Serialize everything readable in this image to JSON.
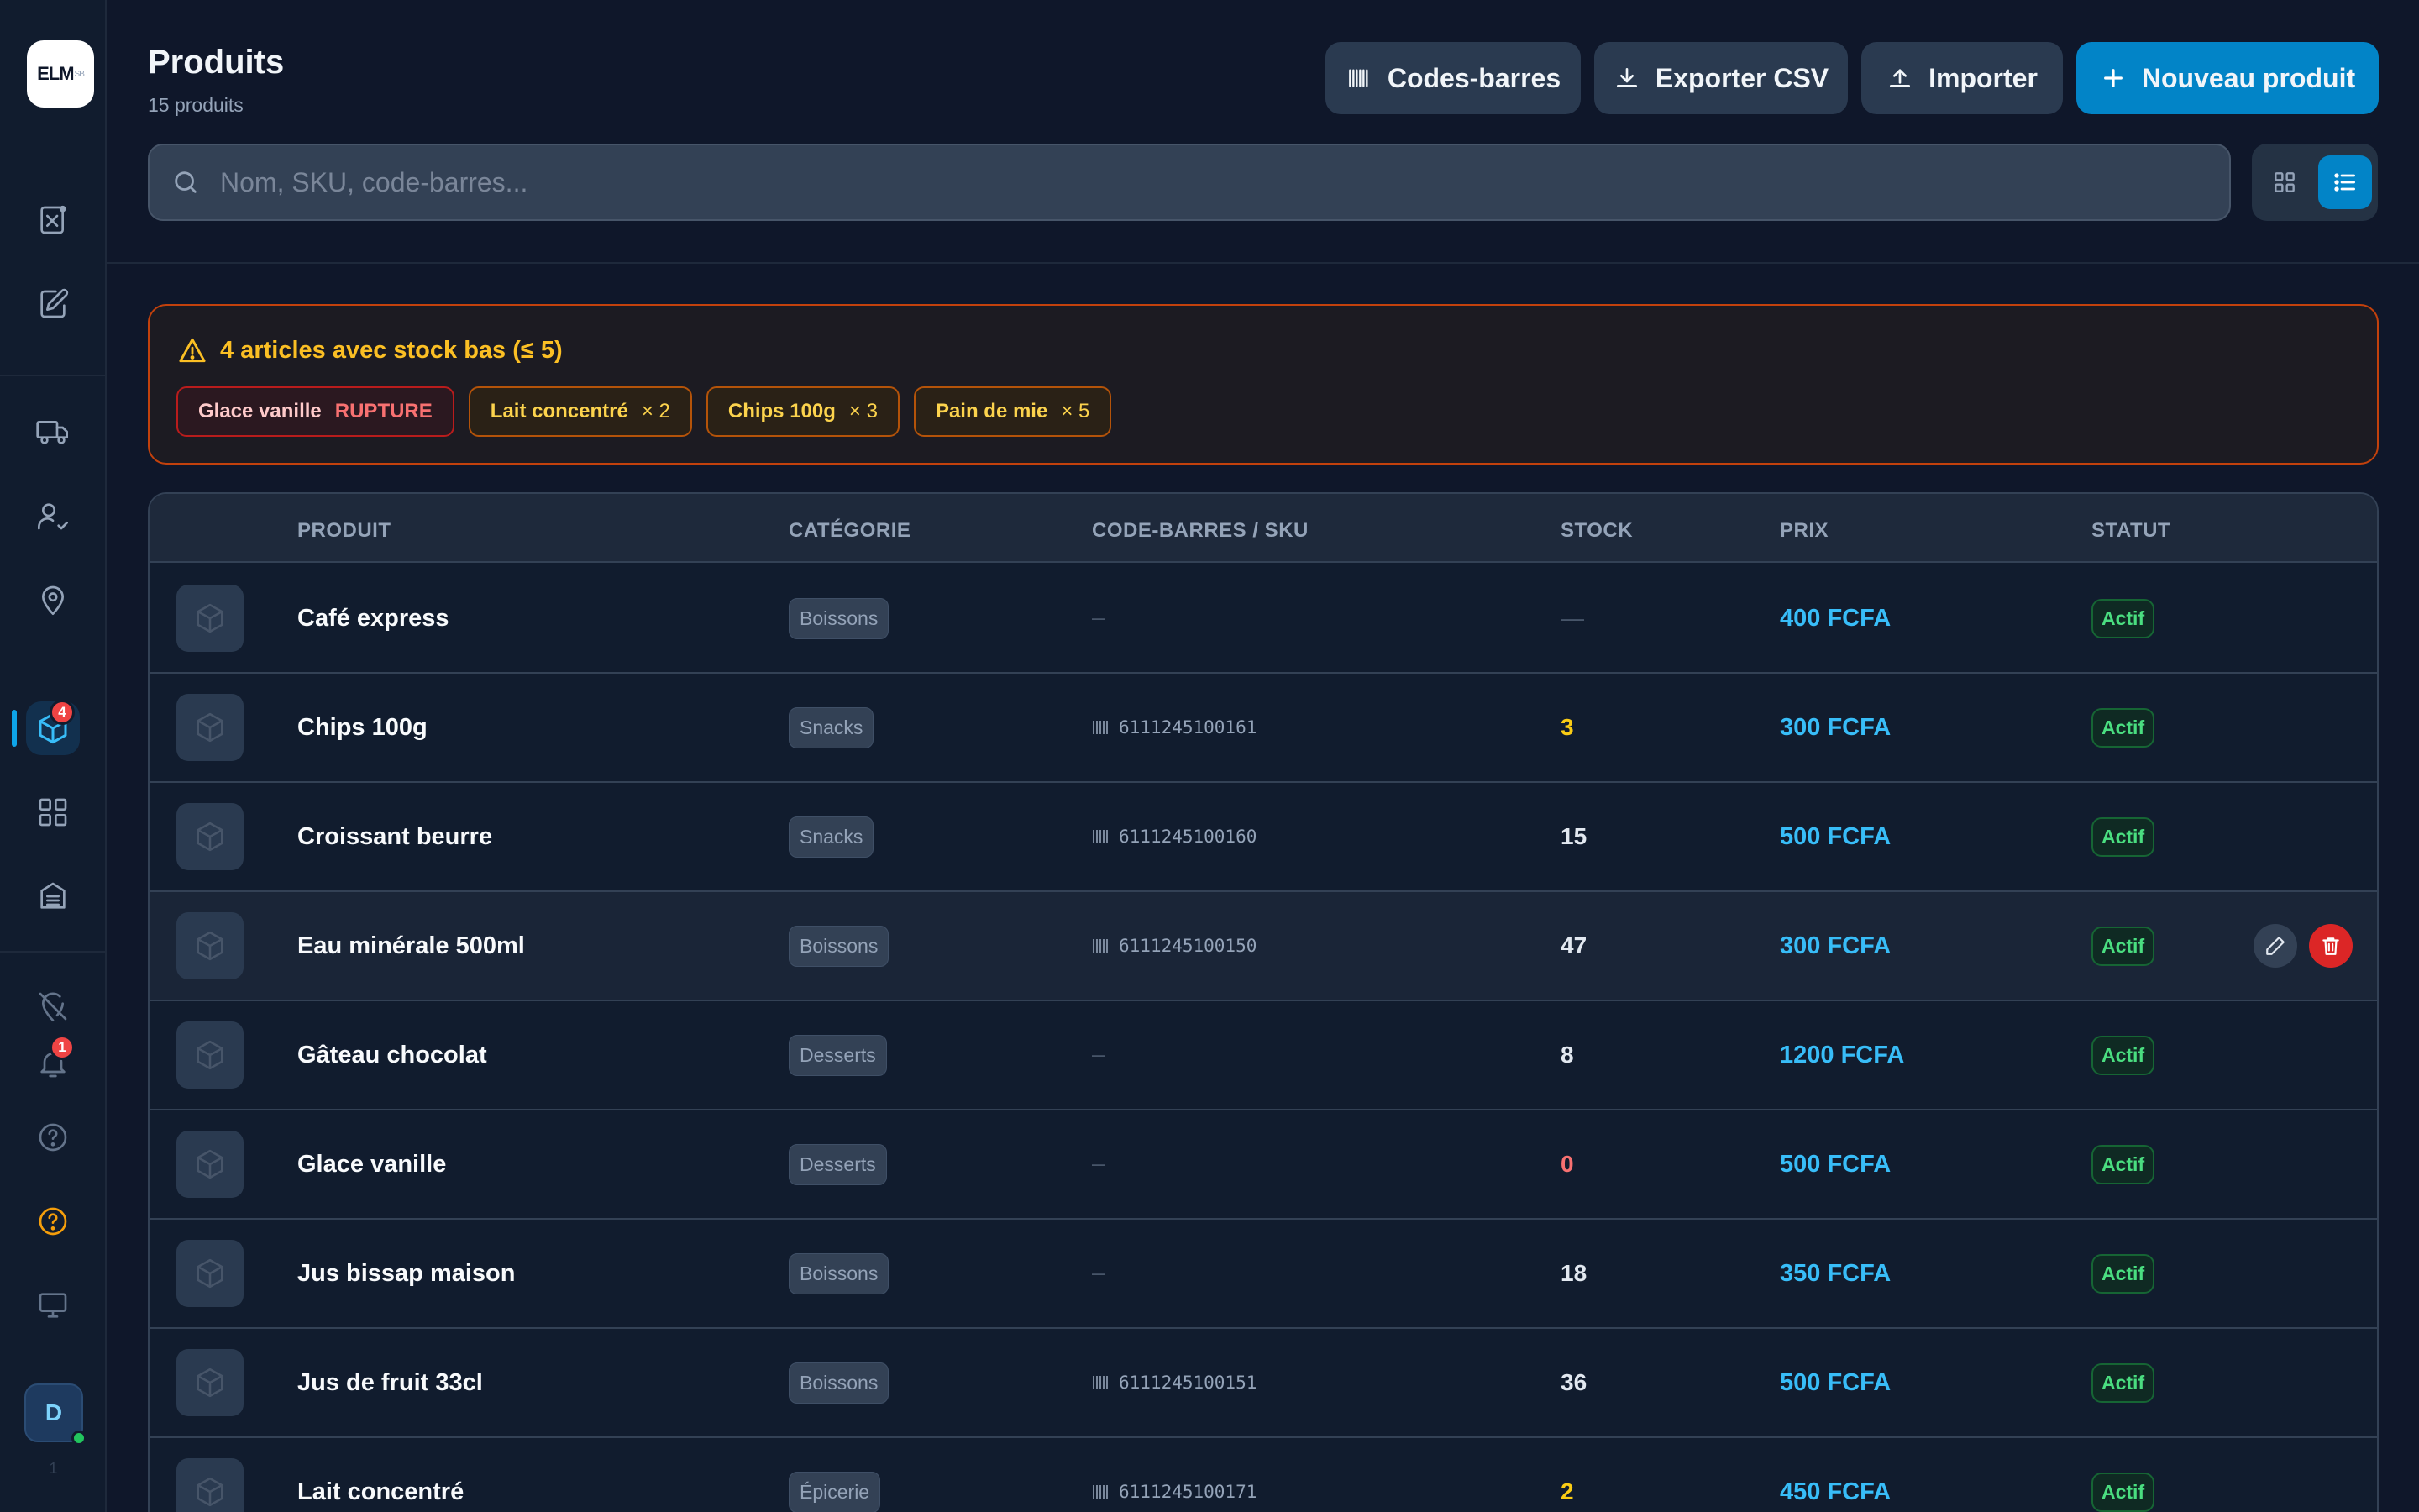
{
  "sidebar": {
    "logo": "ELM",
    "logo_suffix": "SB",
    "nav": [
      {
        "icon": "receipt-icon",
        "label": ""
      },
      {
        "icon": "edit-document-icon",
        "label": ""
      },
      {
        "icon": "truck-icon",
        "label": ""
      },
      {
        "icon": "user-check-icon",
        "label": ""
      },
      {
        "icon": "map-pin-icon",
        "label": ""
      },
      {
        "icon": "cube-icon",
        "badge": "4",
        "active": true
      },
      {
        "icon": "grid-icon"
      },
      {
        "icon": "archive-icon"
      }
    ],
    "bottom": [
      {
        "icon": "location-off-icon"
      },
      {
        "icon": "bell-icon",
        "badge": "1"
      },
      {
        "icon": "help-icon"
      },
      {
        "icon": "help-highlight-icon"
      },
      {
        "icon": "monitor-icon"
      }
    ],
    "avatar_initial": "D",
    "footer": "1"
  },
  "header": {
    "title": "Produits",
    "subtitle": "15 produits",
    "buttons": {
      "barcodes": "Codes-barres",
      "export": "Exporter CSV",
      "import": "Importer",
      "new": "Nouveau produit"
    },
    "search_placeholder": "Nom, SKU, code-barres..."
  },
  "alert": {
    "title": "4 articles avec stock bas (≤ 5)",
    "chips": [
      {
        "name": "Glace vanille",
        "qty": "RUPTURE",
        "level": "out"
      },
      {
        "name": "Lait concentré",
        "qty": "× 2",
        "level": "low"
      },
      {
        "name": "Chips 100g",
        "qty": "× 3",
        "level": "low"
      },
      {
        "name": "Pain de mie",
        "qty": "× 5",
        "level": "low"
      }
    ]
  },
  "table": {
    "columns": {
      "product": "PRODUIT",
      "category": "CATÉGORIE",
      "barcode": "CODE-BARRES / SKU",
      "stock": "STOCK",
      "price": "PRIX",
      "status": "STATUT"
    },
    "rows": [
      {
        "name": "Café express",
        "category": "Boissons",
        "barcode": "—",
        "stock": "—",
        "stock_level": "none",
        "price": "400 FCFA",
        "status": "Actif"
      },
      {
        "name": "Chips 100g",
        "category": "Snacks",
        "barcode": "6111245100161",
        "stock": "3",
        "stock_level": "low",
        "price": "300 FCFA",
        "status": "Actif"
      },
      {
        "name": "Croissant beurre",
        "category": "Snacks",
        "barcode": "6111245100160",
        "stock": "15",
        "stock_level": "ok",
        "price": "500 FCFA",
        "status": "Actif"
      },
      {
        "name": "Eau minérale 500ml",
        "category": "Boissons",
        "barcode": "6111245100150",
        "stock": "47",
        "stock_level": "ok",
        "price": "300 FCFA",
        "status": "Actif",
        "hover": true
      },
      {
        "name": "Gâteau chocolat",
        "category": "Desserts",
        "barcode": "—",
        "stock": "8",
        "stock_level": "ok",
        "price": "1200 FCFA",
        "status": "Actif"
      },
      {
        "name": "Glace vanille",
        "category": "Desserts",
        "barcode": "—",
        "stock": "0",
        "stock_level": "out",
        "price": "500 FCFA",
        "status": "Actif"
      },
      {
        "name": "Jus bissap maison",
        "category": "Boissons",
        "barcode": "—",
        "stock": "18",
        "stock_level": "ok",
        "price": "350 FCFA",
        "status": "Actif"
      },
      {
        "name": "Jus de fruit 33cl",
        "category": "Boissons",
        "barcode": "6111245100151",
        "stock": "36",
        "stock_level": "ok",
        "price": "500 FCFA",
        "status": "Actif"
      },
      {
        "name": "Lait concentré",
        "category": "Épicerie",
        "barcode": "6111245100171",
        "stock": "2",
        "stock_level": "low",
        "price": "450 FCFA",
        "status": "Actif"
      }
    ]
  },
  "colors": {
    "accent": "#0284c7",
    "price": "#38bdf8",
    "status_active": "#4ade80",
    "stock_low": "#facc15",
    "stock_out": "#f87171",
    "alert_border": "#c2410c"
  }
}
